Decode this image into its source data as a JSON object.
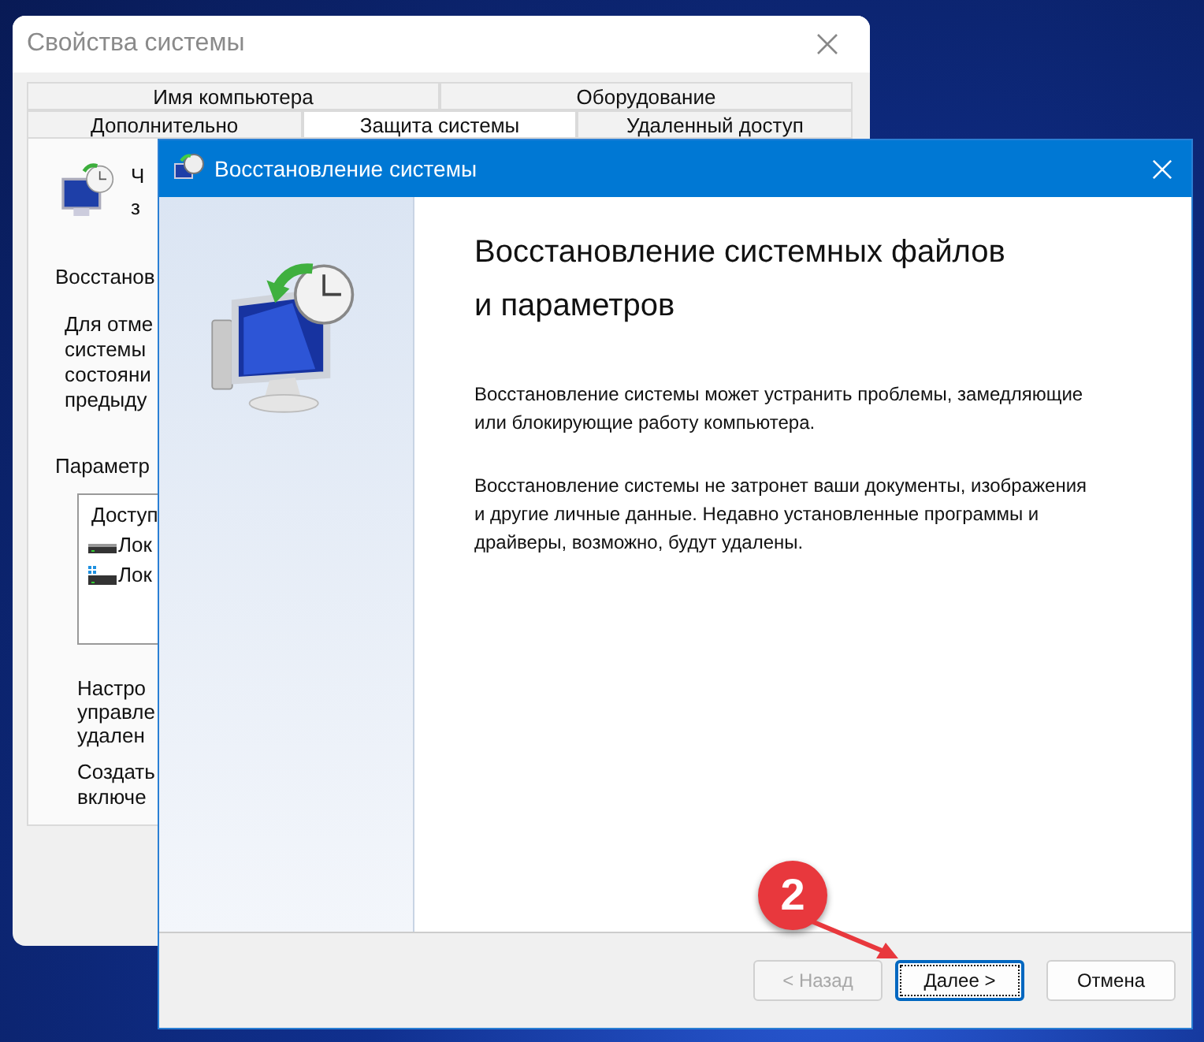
{
  "back_window": {
    "title": "Свойства системы",
    "tabs_row_1": [
      {
        "label": "Имя компьютера",
        "selected": false
      },
      {
        "label": "Оборудование",
        "selected": false
      }
    ],
    "tabs_row_2": [
      {
        "label": "Дополнительно",
        "selected": false
      },
      {
        "label": "Защита системы",
        "selected": true
      },
      {
        "label": "Удаленный доступ",
        "selected": false
      }
    ],
    "intro_lines": [
      "Ч",
      "з"
    ],
    "section_title": "Восстанов",
    "description_lines": [
      "Для отме",
      "системы",
      "состояни",
      "предыду"
    ],
    "parameters_label": "Параметр",
    "list_header": "Доступ",
    "list_items": [
      {
        "label": "Лок",
        "kind": "drive"
      },
      {
        "label": "Лок",
        "kind": "system-drive"
      }
    ],
    "configure_lines": [
      "Настро",
      "управле",
      "удален"
    ],
    "create_lines": [
      "Создать",
      "включе"
    ]
  },
  "dialog": {
    "title": "Восстановление системы",
    "heading": "Восстановление системных файлов и параметров",
    "paragraphs": [
      "Восстановление системы может устранить проблемы, замедляющие или блокирующие работу компьютера.",
      "Восстановление системы не затронет ваши документы, изображения и другие личные данные. Недавно установленные программы и драйверы, возможно, будут удалены."
    ],
    "buttons": [
      {
        "label": "< Назад",
        "disabled": true,
        "focused": false
      },
      {
        "label": "Далее >",
        "disabled": false,
        "focused": true
      },
      {
        "label": "Отмена",
        "disabled": false,
        "focused": false
      }
    ]
  },
  "annotation": {
    "number": "2"
  }
}
